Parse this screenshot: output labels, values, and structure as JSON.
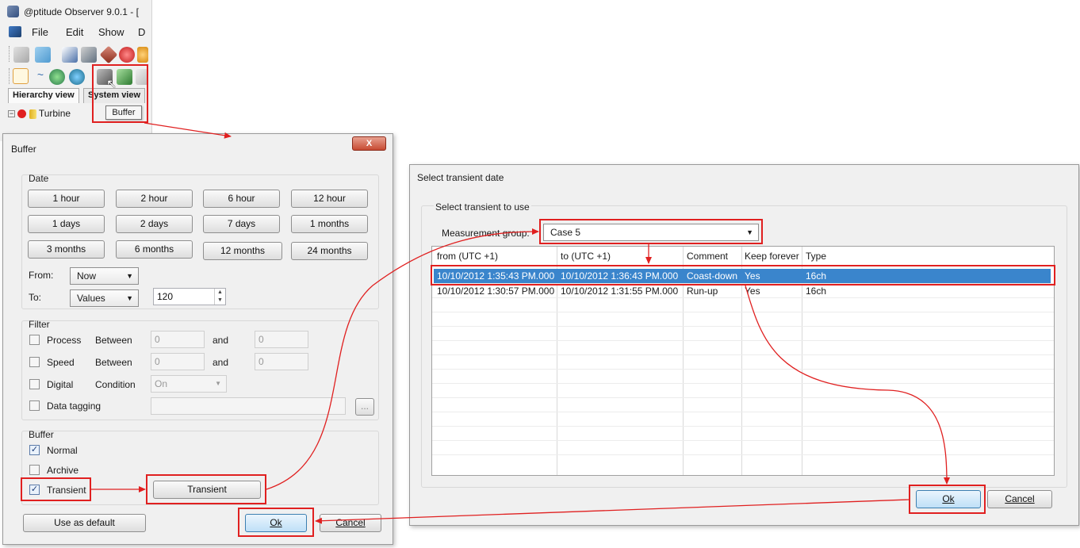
{
  "app": {
    "title": "@ptitude Observer 9.0.1 - [",
    "menu": {
      "file": "File",
      "edit": "Edit",
      "show": "Show",
      "partial": "D"
    },
    "tabs": {
      "hierarchy": "Hierarchy view",
      "system": "System view"
    },
    "tree_item": "Turbine",
    "tooltip": "Buffer"
  },
  "buffer_dialog": {
    "title": "Buffer",
    "close": "X",
    "date": {
      "label": "Date",
      "buttons": [
        "1 hour",
        "2 hour",
        "6 hour",
        "12 hour",
        "1 days",
        "2 days",
        "7 days",
        "1 months",
        "3 months",
        "6 months",
        "12 months",
        "24 months"
      ],
      "from_label": "From:",
      "from_value": "Now",
      "to_label": "To:",
      "to_value": "Values",
      "count_value": "120"
    },
    "filter": {
      "label": "Filter",
      "process": {
        "label": "Process",
        "between": "Between",
        "and": "and",
        "min": "0",
        "max": "0"
      },
      "speed": {
        "label": "Speed",
        "between": "Between",
        "and": "and",
        "min": "0",
        "max": "0"
      },
      "digital": {
        "label": "Digital",
        "condition": "Condition",
        "value": "On"
      },
      "tagging": {
        "label": "Data tagging",
        "browse": "..."
      }
    },
    "buffer": {
      "label": "Buffer",
      "normal": "Normal",
      "archive": "Archive",
      "transient": "Transient",
      "transient_button": "Transient"
    },
    "use_default": "Use as default",
    "ok": "Ok",
    "cancel": "Cancel"
  },
  "transient_dialog": {
    "title": "Select transient date",
    "group_label": "Select transient to use",
    "measurement_group_label": "Measurement group:",
    "measurement_group_value": "Case 5",
    "columns": [
      "from (UTC +1)",
      "to (UTC +1)",
      "Comment",
      "Keep forever",
      "Type"
    ],
    "rows": [
      [
        "10/10/2012 1:35:43 PM.000",
        "10/10/2012 1:36:43 PM.000",
        "Coast-down",
        "Yes",
        "16ch"
      ],
      [
        "10/10/2012 1:30:57 PM.000",
        "10/10/2012 1:31:55 PM.000",
        "Run-up",
        "Yes",
        "16ch"
      ]
    ],
    "ok": "Ok",
    "cancel": "Cancel"
  },
  "colors": {
    "highlight": "#e02020",
    "selection": "#3a85cc",
    "dialog_bg": "#f0f0f0"
  }
}
